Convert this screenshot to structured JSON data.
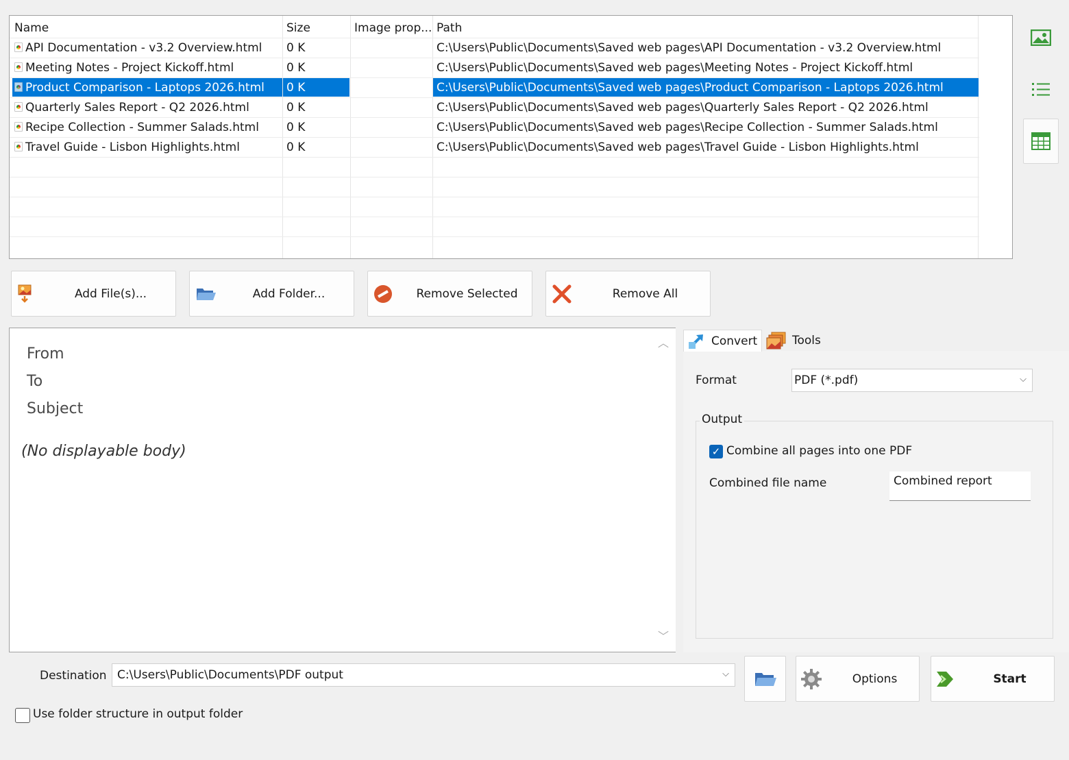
{
  "file_list": {
    "columns": [
      "Name",
      "Size",
      "Image prop...",
      "Path"
    ],
    "rows": [
      {
        "name": "API Documentation - v3.2 Overview.html",
        "size": "0 K",
        "image_prop": "",
        "path": "C:\\Users\\Public\\Documents\\Saved web pages\\API Documentation - v3.2 Overview.html"
      },
      {
        "name": "Meeting Notes - Project Kickoff.html",
        "size": "0 K",
        "image_prop": "",
        "path": "C:\\Users\\Public\\Documents\\Saved web pages\\Meeting Notes - Project Kickoff.html"
      },
      {
        "name": "Product Comparison - Laptops 2026.html",
        "size": "0 K",
        "image_prop": "",
        "path": "C:\\Users\\Public\\Documents\\Saved web pages\\Product Comparison - Laptops 2026.html"
      },
      {
        "name": "Quarterly Sales Report - Q2 2026.html",
        "size": "0 K",
        "image_prop": "",
        "path": "C:\\Users\\Public\\Documents\\Saved web pages\\Quarterly Sales Report - Q2 2026.html"
      },
      {
        "name": "Recipe Collection - Summer Salads.html",
        "size": "0 K",
        "image_prop": "",
        "path": "C:\\Users\\Public\\Documents\\Saved web pages\\Recipe Collection - Summer Salads.html"
      },
      {
        "name": "Travel Guide - Lisbon Highlights.html",
        "size": "0 K",
        "image_prop": "",
        "path": "C:\\Users\\Public\\Documents\\Saved web pages\\Travel Guide - Lisbon Highlights.html"
      }
    ],
    "selected_row_index": 2
  },
  "view_buttons": [
    {
      "icon": "image-view-icon",
      "active": false
    },
    {
      "icon": "list-view-icon",
      "active": false
    },
    {
      "icon": "table-view-icon",
      "active": true
    }
  ],
  "actions": {
    "add_files": {
      "label": "Add File(s)...",
      "icon": "add-file-icon"
    },
    "add_folder": {
      "label": "Add Folder...",
      "icon": "folder-icon"
    },
    "remove_selected": {
      "label": "Remove Selected",
      "icon": "remove-icon"
    },
    "remove_all": {
      "label": "Remove All",
      "icon": "close-icon"
    }
  },
  "preview": {
    "from_label": "From",
    "to_label": "To",
    "subject_label": "Subject",
    "body": "(No displayable body)"
  },
  "tabs": {
    "convert": "Convert",
    "tools": "Tools"
  },
  "convert": {
    "format_label": "Format",
    "format_value": "PDF (*.pdf)",
    "output_label": "Output",
    "combine_label": "Combine all pages into one PDF",
    "combine_checked": true,
    "combined_name_label": "Combined file name",
    "combined_name_value": "Combined report"
  },
  "bottom": {
    "destination_label": "Destination",
    "destination_value": "C:\\Users\\Public\\Documents\\PDF output",
    "options_label": "Options",
    "start_label": "Start",
    "folder_structure_label": "Use folder structure in output folder",
    "folder_structure_checked": false
  },
  "colors": {
    "selection": "#0078d7",
    "checkbox_accent": "#0a64b8",
    "view_icon_green": "#3a9a3a"
  }
}
